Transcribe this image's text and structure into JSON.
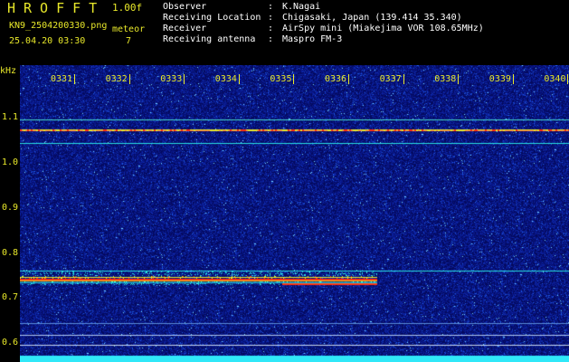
{
  "header": {
    "app_title": "HROFFT",
    "version": "1.00f",
    "filename": "KN9_2504200330.png",
    "datetime": "25.04.20 03:30",
    "meteor_label": "meteor",
    "meteor_count": "7"
  },
  "info": [
    {
      "key": "Observer",
      "value": "K.Nagai"
    },
    {
      "key": "Receiving Location",
      "value": "Chigasaki, Japan (139.414 35.340)"
    },
    {
      "key": "Receiver",
      "value": "AirSpy mini (Miakejima VOR 108.65MHz)"
    },
    {
      "key": "Receiving antenna",
      "value": "Maspro FM-3"
    }
  ],
  "axis": {
    "y_unit": "kHz",
    "y_ticks": [
      "1.1",
      "1.0",
      "0.9",
      "0.8",
      "0.7",
      "0.6"
    ],
    "x_ticks": [
      "0331",
      "0332",
      "0333",
      "0334",
      "0335",
      "0336",
      "0337",
      "0338",
      "0339",
      "0340"
    ]
  },
  "colors": {
    "label": "#e8e82a",
    "background_noise": "#0a1a8c",
    "signal_hot": "#ff3010",
    "signal_warm": "#e8e82a",
    "signal_cool": "#28e0e0"
  }
}
